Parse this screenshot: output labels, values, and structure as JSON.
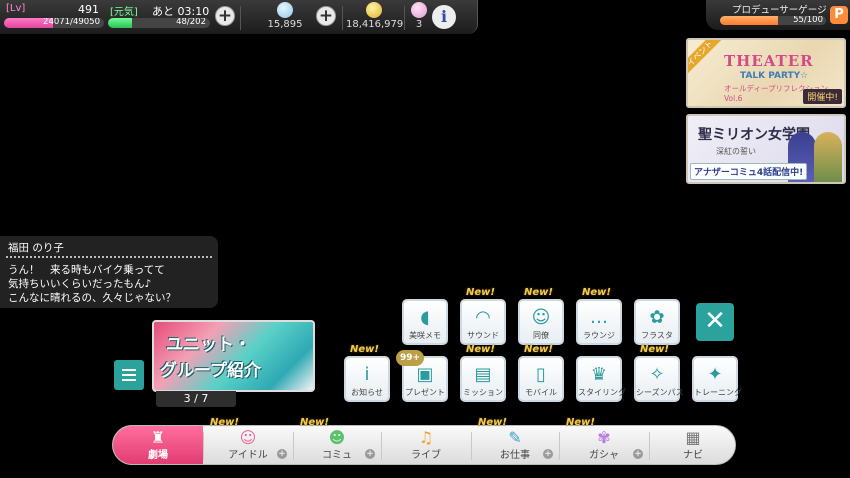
{
  "status": {
    "lv_label": "[Lv]",
    "lv_value": "491",
    "exp_text": "24071/49050",
    "exp_fraction": 0.49,
    "stamina_label": "[元気]",
    "stamina_time": "あと 03:10",
    "stamina_text": "48/202",
    "stamina_fraction": 0.24,
    "jewels": "15,895",
    "money": "18,416,979",
    "candy": "3"
  },
  "producer_gauge": {
    "label": "プロデューサーゲージ",
    "value_text": "55/100",
    "fraction": 0.55,
    "icon_letter": "P"
  },
  "banners": [
    {
      "corner": "イベント",
      "title": "THEATER",
      "subtitle": "TALK PARTY☆",
      "vol": "オールディープリフレクション Vol.6",
      "tag": "開催中!"
    },
    {
      "title": "聖ミリオン女学園",
      "subtitle": "深紅の誓い",
      "tag": "アナザーコミュ4話配信中!"
    }
  ],
  "dialog": {
    "speaker": "福田 のり子",
    "lines": [
      "うん！　来る時もバイク乗ってて",
      "気持ちいいくらいだったもん♪",
      "こんなに晴れるの、久々じゃない？"
    ]
  },
  "unit_card": {
    "title_line1": "ユニット・",
    "title_line2": "グループ紹介",
    "counter": "3 / 7"
  },
  "grid": {
    "new_label": "New!",
    "present_badge": "99+",
    "row1": [
      {
        "label": "美咲メモ",
        "icon": "beginner-mark-icon",
        "glyph": "◖",
        "new": false
      },
      {
        "label": "サウンド",
        "icon": "headphones-icon",
        "glyph": "◠",
        "new": true
      },
      {
        "label": "同僚",
        "icon": "person-icon",
        "glyph": "☺",
        "new": true
      },
      {
        "label": "ラウンジ",
        "icon": "chat-bubble-icon",
        "glyph": "…",
        "new": true
      },
      {
        "label": "フラスタ",
        "icon": "flower-icon",
        "glyph": "✿",
        "new": false
      }
    ],
    "row2": [
      {
        "label": "お知らせ",
        "icon": "info-icon",
        "glyph": "ⅰ",
        "new": true
      },
      {
        "label": "プレゼント",
        "icon": "present-box-icon",
        "glyph": "▣",
        "new": false
      },
      {
        "label": "ミッション",
        "icon": "mission-card-icon",
        "glyph": "▤",
        "new": true
      },
      {
        "label": "モバイル",
        "icon": "smartphone-icon",
        "glyph": "▯",
        "new": true
      },
      {
        "label": "スタイリング",
        "icon": "dress-icon",
        "glyph": "♛",
        "new": false
      },
      {
        "label": "シーズンパス",
        "icon": "season-pass-icon",
        "glyph": "✧",
        "new": true
      },
      {
        "label": "トレーニング",
        "icon": "sparkle-icon",
        "glyph": "✦",
        "new": false
      }
    ]
  },
  "nav": {
    "items": [
      {
        "label": "劇場",
        "icon": "theater-icon",
        "glyph": "♜",
        "new": false,
        "plus": false
      },
      {
        "label": "アイドル",
        "icon": "idol-icon",
        "glyph": "☺",
        "new": true,
        "plus": true
      },
      {
        "label": "コミュ",
        "icon": "commu-icon",
        "glyph": "☻",
        "new": true,
        "plus": true
      },
      {
        "label": "ライブ",
        "icon": "music-note-icon",
        "glyph": "♫",
        "new": false,
        "plus": false
      },
      {
        "label": "お仕事",
        "icon": "clipboard-icon",
        "glyph": "✎",
        "new": true,
        "plus": true
      },
      {
        "label": "ガシャ",
        "icon": "butterfly-icon",
        "glyph": "✾",
        "new": true,
        "plus": true
      },
      {
        "label": "ナビ",
        "icon": "grid-icon",
        "glyph": "▦",
        "new": false,
        "plus": false
      }
    ]
  },
  "colors": {
    "teal": "#2ba29c",
    "pink_active": "#e23c73",
    "new_gold": "#f2c94c"
  }
}
